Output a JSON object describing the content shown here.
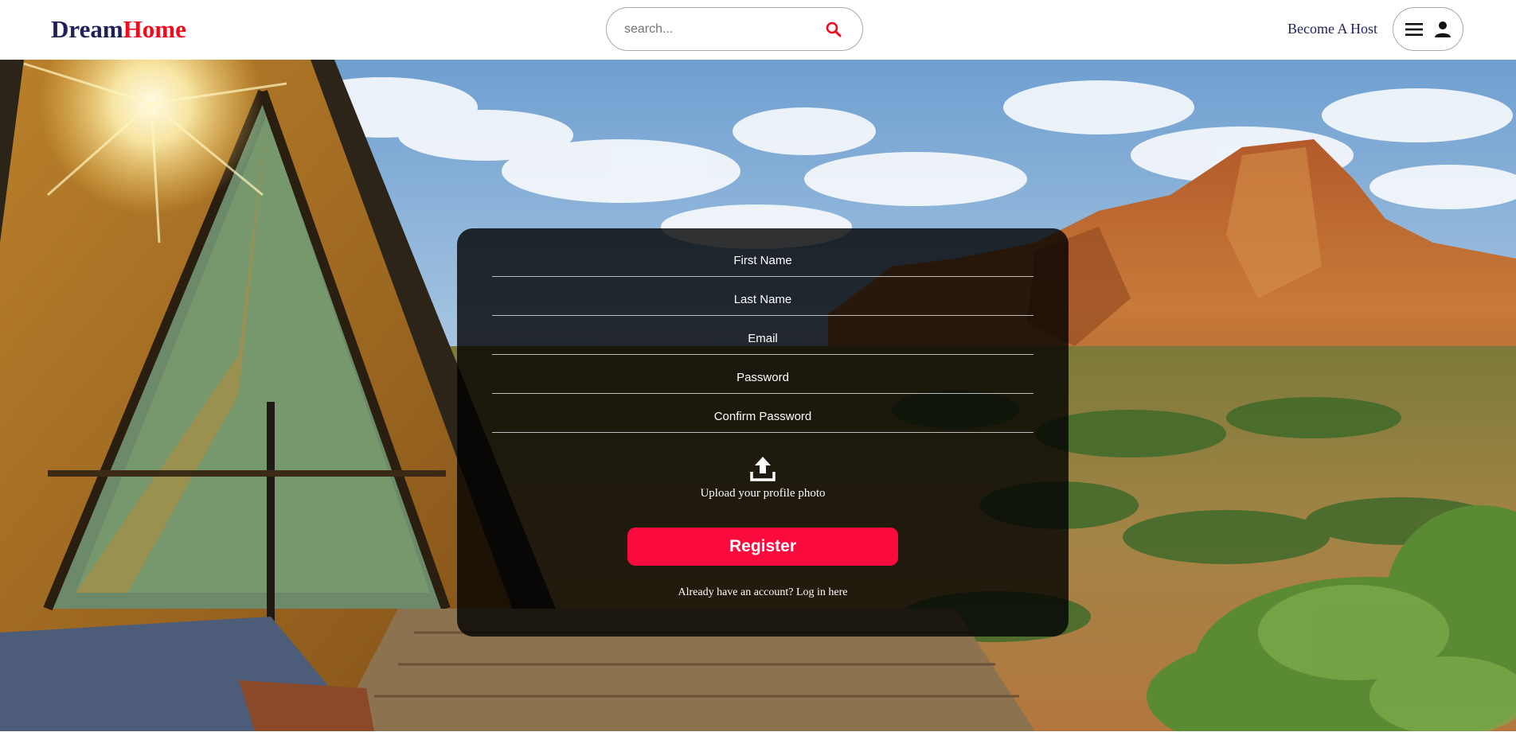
{
  "header": {
    "logo_part_a": "Dream",
    "logo_part_b": "Home",
    "search_placeholder": "search...",
    "search_icon": "search-icon",
    "become_host": "Become A Host",
    "menu_icon": "hamburger-menu-icon",
    "user_icon": "person-icon"
  },
  "register": {
    "fields": {
      "first_name": "First Name",
      "last_name": "Last Name",
      "email": "Email",
      "password": "Password",
      "confirm_password": "Confirm Password"
    },
    "upload_icon": "upload-icon",
    "upload_label": "Upload your profile photo",
    "register_button": "Register",
    "login_link": "Already have an account? Log in here"
  },
  "colors": {
    "brand_dark": "#1f1f5c",
    "brand_red": "#f8071b",
    "register_button": "#fb0a3e"
  }
}
